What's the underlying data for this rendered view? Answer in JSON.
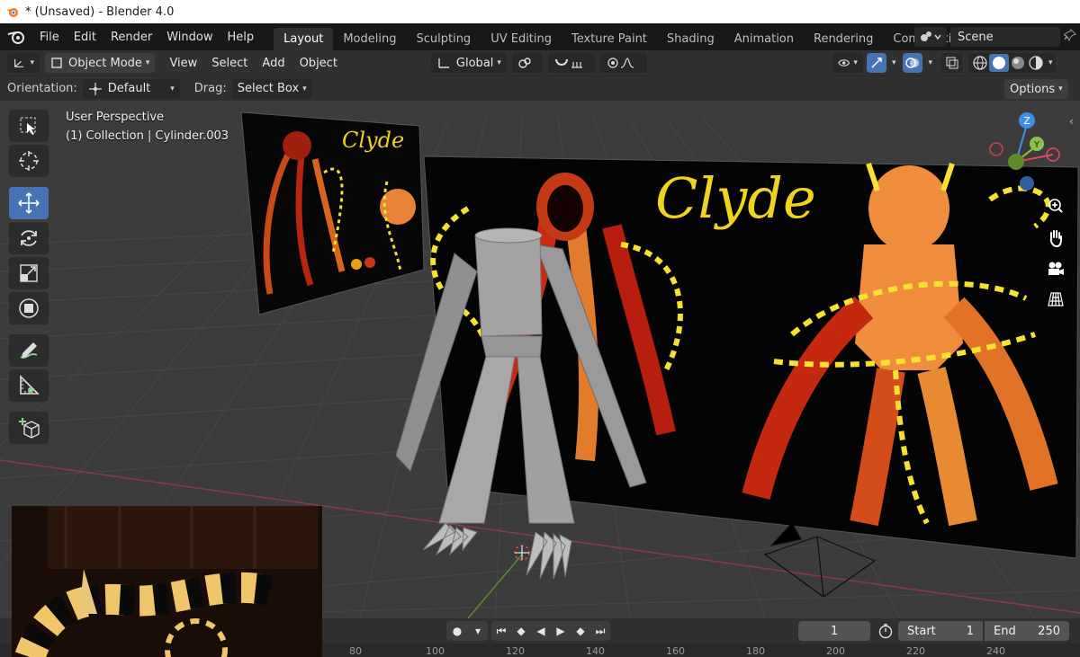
{
  "window": {
    "title": "* (Unsaved) - Blender 4.0"
  },
  "menu": [
    "File",
    "Edit",
    "Render",
    "Window",
    "Help"
  ],
  "workspaces": [
    "Layout",
    "Modeling",
    "Sculpting",
    "UV Editing",
    "Texture Paint",
    "Shading",
    "Animation",
    "Rendering",
    "Compositing"
  ],
  "scene": {
    "name": "Scene"
  },
  "header": {
    "mode": "Object Mode",
    "menus": [
      "View",
      "Select",
      "Add",
      "Object"
    ],
    "transform_orientation": "Global"
  },
  "tool_settings": {
    "orientation_label": "Orientation:",
    "orientation_value": "Default",
    "drag_label": "Drag:",
    "drag_value": "Select Box",
    "options_label": "Options"
  },
  "viewport": {
    "perspective": "User Perspective",
    "object_info": "(1) Collection | Cylinder.003",
    "reference_image_text": "Clyde",
    "reference_image_small_text": "Clyde",
    "gizmo_axes": {
      "z": "Z",
      "y": "Y"
    }
  },
  "timeline": {
    "current_frame": "1",
    "start_label": "Start",
    "start_value": "1",
    "end_label": "End",
    "end_value": "250",
    "ruler_ticks": [
      "80",
      "100",
      "120",
      "140",
      "160",
      "180",
      "200",
      "220",
      "240"
    ]
  },
  "colors": {
    "accent": "#4772b3",
    "axis_x": "#e8475b",
    "axis_y": "#8bc34a",
    "axis_z": "#3d8fe3"
  }
}
